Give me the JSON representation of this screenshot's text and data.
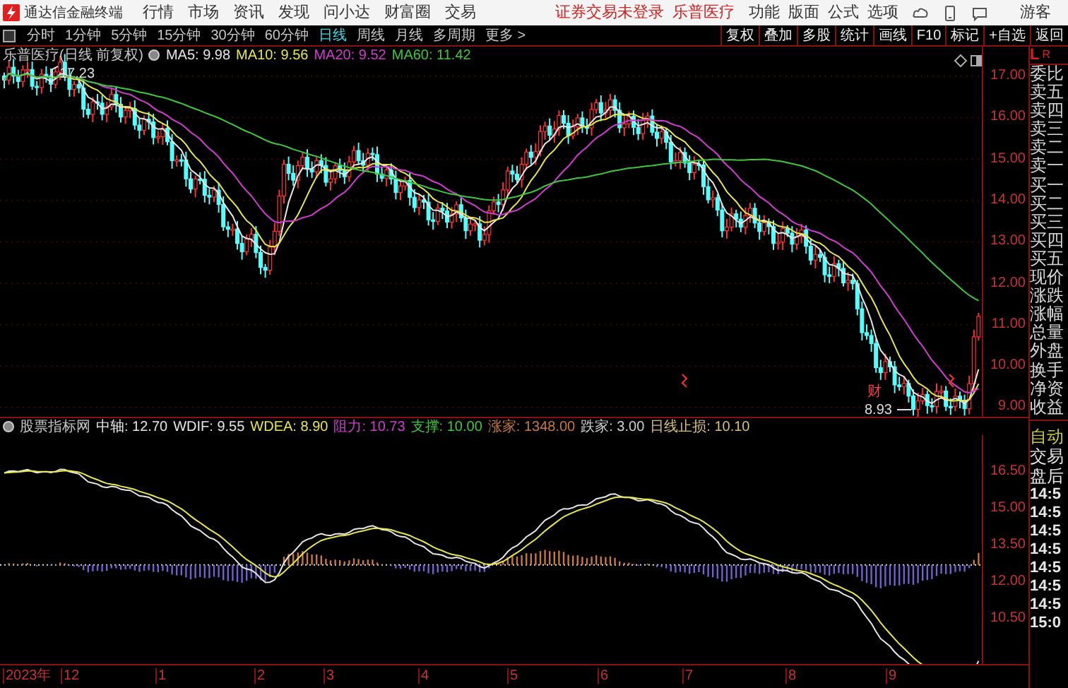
{
  "title_bar": {
    "app_name": "通达信金融终端",
    "menu": [
      "行情",
      "市场",
      "资讯",
      "发现",
      "问小达",
      "财富圈",
      "交易"
    ],
    "login_status": "证券交易未登录",
    "stock_name": "乐普医疗",
    "tools": [
      "功能",
      "版面",
      "公式",
      "选项"
    ],
    "user": "游客"
  },
  "period_tabs": [
    {
      "label": "分时",
      "selected": false
    },
    {
      "label": "1分钟",
      "selected": false
    },
    {
      "label": "5分钟",
      "selected": false
    },
    {
      "label": "15分钟",
      "selected": false
    },
    {
      "label": "30分钟",
      "selected": false
    },
    {
      "label": "60分钟",
      "selected": false
    },
    {
      "label": "日线",
      "selected": true
    },
    {
      "label": "周线",
      "selected": false
    },
    {
      "label": "月线",
      "selected": false
    },
    {
      "label": "多周期",
      "selected": false
    },
    {
      "label": "更多 >",
      "selected": false
    }
  ],
  "chart_toolbar": [
    "复权",
    "叠加",
    "多股",
    "统计",
    "画线",
    "F10",
    "标记",
    "+自选",
    "返回"
  ],
  "main_chart": {
    "title": "乐普医疗(日线 前复权)",
    "indicators": [
      {
        "label": "MA5: 9.98",
        "color": "#e6e6e6"
      },
      {
        "label": "MA10: 9.56",
        "color": "#e8e64a"
      },
      {
        "label": "MA20: 9.52",
        "color": "#d23cd2"
      },
      {
        "label": "MA60: 11.42",
        "color": "#3cc83c"
      }
    ],
    "high_label": "17.23",
    "low_label": "8.93",
    "event_tag": "财",
    "price_axis": [
      "17.00",
      "16.00",
      "15.00",
      "14.00",
      "13.00",
      "12.00",
      "11.00",
      "10.00",
      "9.00"
    ]
  },
  "indicator_panel": {
    "title": "股票指标网",
    "values": [
      {
        "label": "中轴: 12.70",
        "color": "#e6e6e6"
      },
      {
        "label": "WDIF: 9.55",
        "color": "#e6e6e6"
      },
      {
        "label": "WDEA: 8.90",
        "color": "#e8e64a"
      },
      {
        "label": "阻力: 10.73",
        "color": "#d23cd2"
      },
      {
        "label": "支撑: 10.00",
        "color": "#3cc83c"
      },
      {
        "label": "涨家: 1348.00",
        "color": "#c8783c"
      },
      {
        "label": "跌家: 3.00",
        "color": "#d0d0d0"
      },
      {
        "label": "日线止损: 10.10",
        "color": "#d8c070"
      }
    ],
    "axis": [
      "16.50",
      "15.00",
      "13.50",
      "12.00",
      "10.50"
    ]
  },
  "time_axis": [
    "2023年",
    "12",
    "1",
    "2",
    "3",
    "4",
    "5",
    "6",
    "7",
    "8",
    "9"
  ],
  "quote_panel": {
    "corner": [
      "L",
      "R"
    ],
    "labels": [
      "委比",
      "卖五",
      "卖四",
      "卖三",
      "卖二",
      "卖一",
      "买一",
      "买二",
      "买三",
      "买四",
      "买五",
      "现价",
      "涨跌",
      "涨幅",
      "总量",
      "外盘",
      "换手",
      "净资",
      "收益"
    ],
    "status": [
      {
        "label": "自动",
        "color": "#c8c83c"
      },
      {
        "label": "交易",
        "color": "#e6e6e6"
      },
      {
        "label": "盘后",
        "color": "#e6e6e6"
      }
    ],
    "times": [
      "14:5",
      "14:5",
      "14:5",
      "14:5",
      "14:5",
      "14:5",
      "14:5",
      "15:0"
    ]
  }
}
